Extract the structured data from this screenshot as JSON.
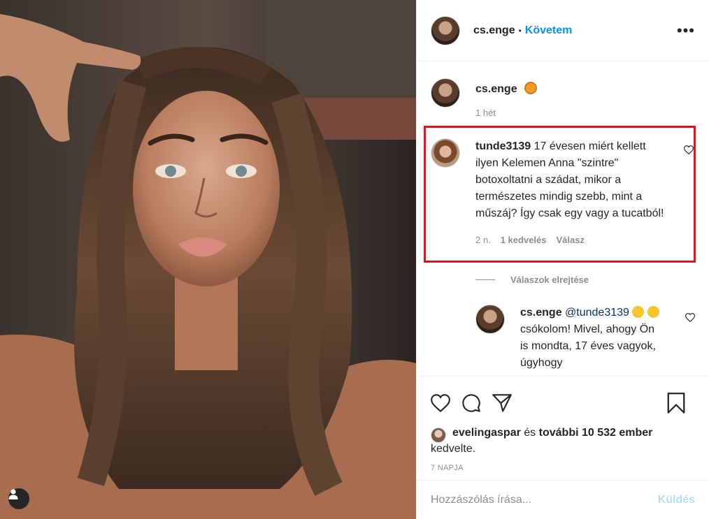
{
  "post": {
    "author": "cs.enge",
    "follow_label": "Követem",
    "follow_separator": "•",
    "more_label": "•••"
  },
  "caption": {
    "author": "cs.enge",
    "emoji": "tiger-emoji",
    "time": "1 hét"
  },
  "comment": {
    "author": "tunde3139",
    "text": "17 évesen miért kellett ilyen Kelemen Anna \"szintre\" botoxoltatni a szádat, mikor a természetes mindig szebb, mint a műszáj? Így csak egy vagy a tucatból!",
    "time": "2 n.",
    "likes": "1 kedvelés",
    "reply_label": "Válasz",
    "highlight_color": "#e0141c"
  },
  "replies_toggle": {
    "label": "Válaszok elrejtése"
  },
  "reply": {
    "author": "cs.enge",
    "mention": "@tunde3139",
    "text": "csókolom! Mivel, ahogy Ön is mondta, 17 éves vagyok, úgyhogy"
  },
  "likes": {
    "user": "evelingaspar",
    "conj": "és",
    "others": "további 10 532 ember",
    "suffix": "kedvelte."
  },
  "date": "7 NAPJA",
  "comment_box": {
    "placeholder": "Hozzászólás írása...",
    "post_label": "Küldés"
  },
  "colors": {
    "accent": "#0095f6",
    "muted": "#8e8e8e",
    "border": "#efefef"
  }
}
